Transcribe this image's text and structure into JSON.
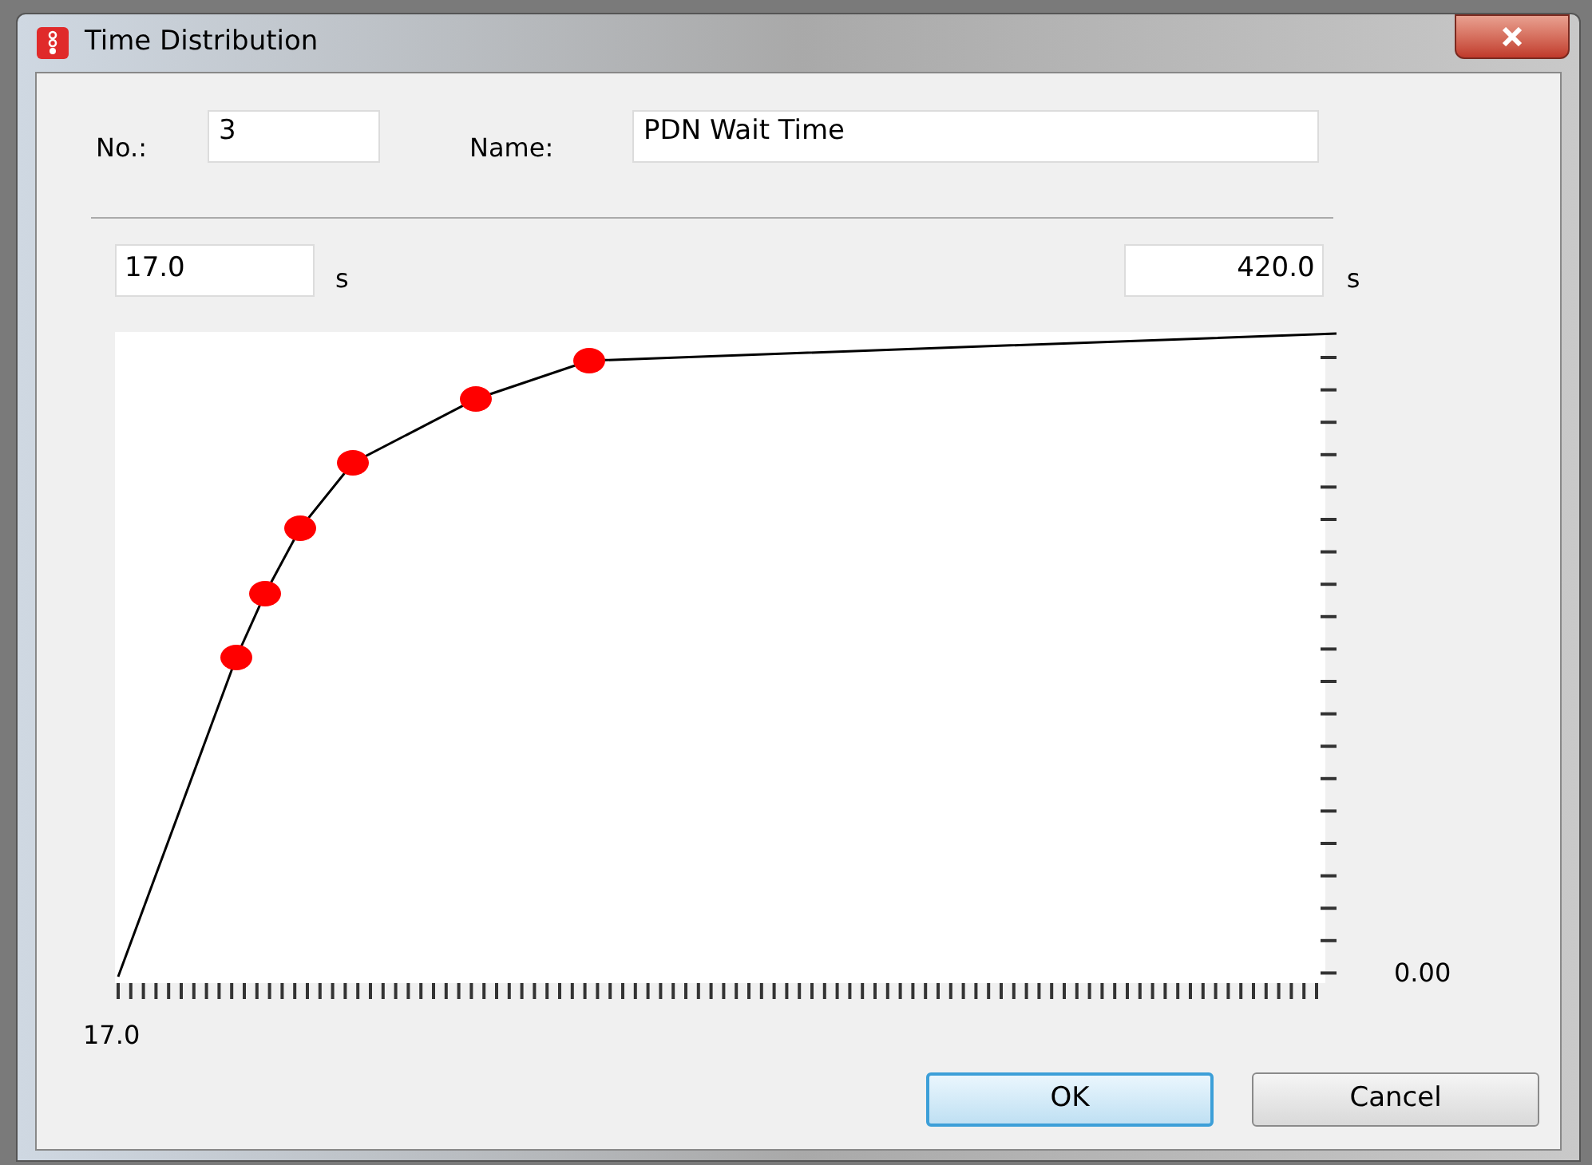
{
  "window": {
    "title": "Time Distribution"
  },
  "fields": [
    {
      "kind": "number",
      "label": "No.:",
      "value": "3"
    },
    {
      "kind": "name",
      "label": "Name:",
      "value": "PDN Wait Time"
    }
  ],
  "range": {
    "min": {
      "value": "17.0",
      "unit": "s"
    },
    "max": {
      "value": "420.0",
      "unit": "s"
    }
  },
  "chart": {
    "x_start_label": "17.0",
    "y_start_label": "0.00"
  },
  "buttons": [
    {
      "label": "OK",
      "default": true
    },
    {
      "label": "Cancel",
      "default": false
    }
  ]
}
